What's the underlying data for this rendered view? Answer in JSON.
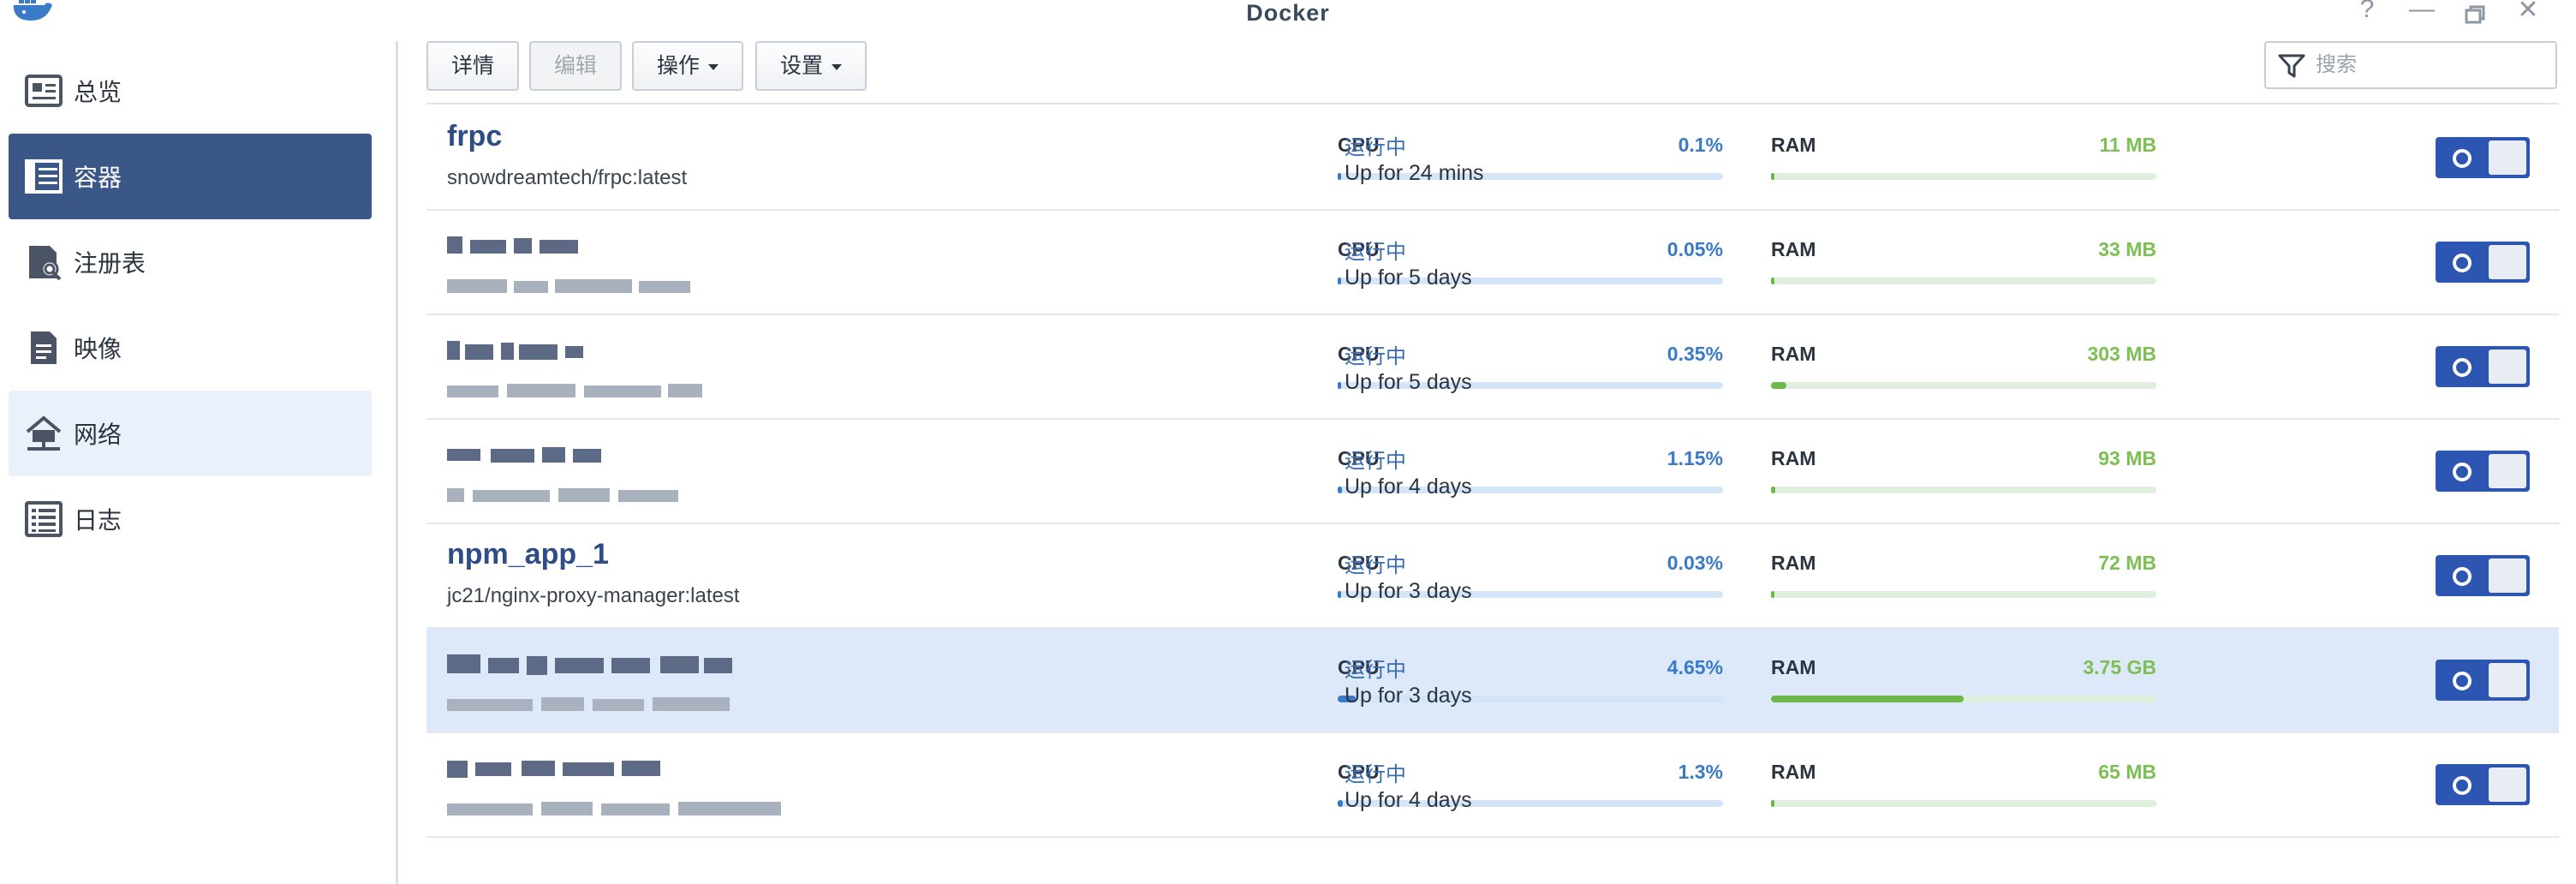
{
  "window": {
    "title": "Docker",
    "controls": [
      "help-icon",
      "minimize-icon",
      "maximize-icon",
      "close-icon"
    ]
  },
  "sidebar": {
    "items": [
      {
        "label": "总览",
        "icon": "overview-icon",
        "state": "normal"
      },
      {
        "label": "容器",
        "icon": "container-icon",
        "state": "active"
      },
      {
        "label": "注册表",
        "icon": "registry-icon",
        "state": "normal"
      },
      {
        "label": "映像",
        "icon": "image-icon",
        "state": "normal"
      },
      {
        "label": "网络",
        "icon": "network-icon",
        "state": "hover"
      },
      {
        "label": "日志",
        "icon": "log-icon",
        "state": "normal"
      }
    ]
  },
  "toolbar": {
    "details_label": "详情",
    "edit_label": "编辑",
    "action_label": "操作",
    "settings_label": "设置",
    "search_placeholder": "搜索"
  },
  "labels": {
    "cpu": "CPU",
    "ram": "RAM"
  },
  "colors": {
    "accent": "#3b5788",
    "name": "#2e4c86",
    "cpu": "#3a7bc8",
    "ram": "#6db84a",
    "selected_row": "#dde9f8",
    "toggle_on": "#2c56b2"
  },
  "containers": [
    {
      "name": "frpc",
      "image": "snowdreamtech/frpc:latest",
      "cpu": "0.1%",
      "cpu_frac": 0.001,
      "ram": "11 MB",
      "ram_frac": 0.003,
      "state": "运行中",
      "uptime": "Up for 24 mins",
      "enabled": true,
      "selected": false
    },
    {
      "name": "",
      "image": "",
      "cpu": "0.05%",
      "cpu_frac": 0.0005,
      "ram": "33 MB",
      "ram_frac": 0.005,
      "state": "运行中",
      "uptime": "Up for 5 days",
      "enabled": true,
      "selected": false
    },
    {
      "name": "",
      "image": "",
      "cpu": "0.35%",
      "cpu_frac": 0.0035,
      "ram": "303 MB",
      "ram_frac": 0.04,
      "state": "运行中",
      "uptime": "Up for 5 days",
      "enabled": true,
      "selected": false
    },
    {
      "name": "",
      "image": "",
      "cpu": "1.15%",
      "cpu_frac": 0.0115,
      "ram": "93 MB",
      "ram_frac": 0.012,
      "state": "运行中",
      "uptime": "Up for 4 days",
      "enabled": true,
      "selected": false
    },
    {
      "name": "npm_app_1",
      "image": "jc21/nginx-proxy-manager:latest",
      "cpu": "0.03%",
      "cpu_frac": 0.0003,
      "ram": "72 MB",
      "ram_frac": 0.009,
      "state": "运行中",
      "uptime": "Up for 3 days",
      "enabled": true,
      "selected": false
    },
    {
      "name": "",
      "image": "",
      "cpu": "4.65%",
      "cpu_frac": 0.0465,
      "ram": "3.75 GB",
      "ram_frac": 0.5,
      "state": "运行中",
      "uptime": "Up for 3 days",
      "enabled": true,
      "selected": true
    },
    {
      "name": "",
      "image": "",
      "cpu": "1.3%",
      "cpu_frac": 0.013,
      "ram": "65 MB",
      "ram_frac": 0.008,
      "state": "运行中",
      "uptime": "Up for 4 days",
      "enabled": true,
      "selected": false
    }
  ]
}
